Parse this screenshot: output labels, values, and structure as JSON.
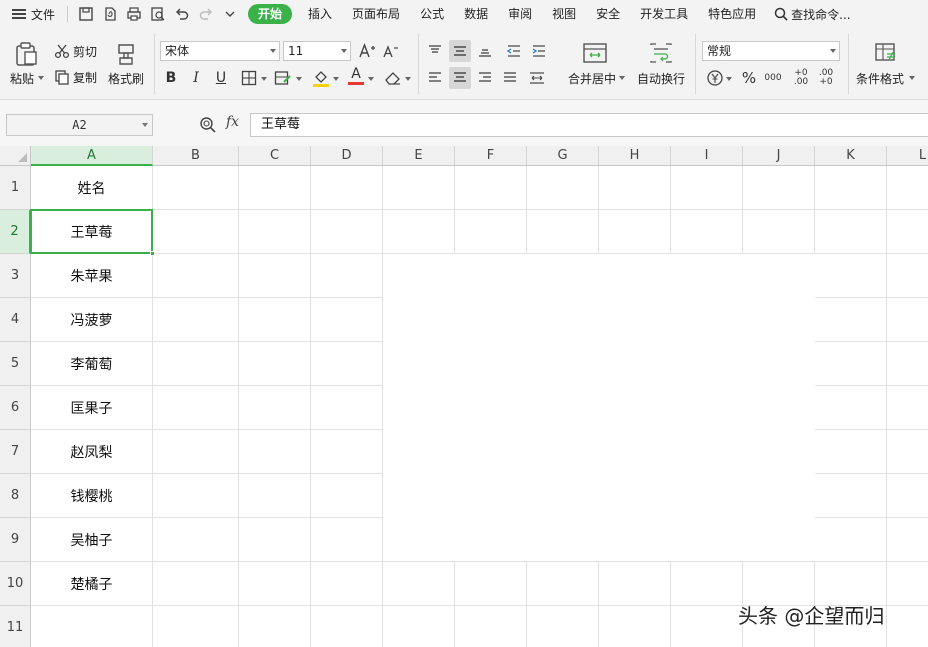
{
  "menubar": {
    "file": "文件",
    "tabs": [
      "开始",
      "插入",
      "页面布局",
      "公式",
      "数据",
      "审阅",
      "视图",
      "安全",
      "开发工具",
      "特色应用"
    ],
    "active_tab_index": 0,
    "search": "查找命令..."
  },
  "ribbon": {
    "paste": "粘贴",
    "cut": "剪切",
    "copy": "复制",
    "format_painter": "格式刷",
    "font_name": "宋体",
    "font_size": "11",
    "bold": "B",
    "italic": "I",
    "underline": "U",
    "font_color_letter": "A",
    "merge_center": "合并居中",
    "wrap_text": "自动换行",
    "number_format": "常规",
    "percent": "%",
    "thousands": "000",
    "inc_decimal": "+0 .00",
    "dec_decimal": ".00 +0",
    "conditional_format": "条件格式",
    "accent_color": "#3bb14a",
    "font_color_bar": "#e53935",
    "fill_color_bar": "#f5d20a"
  },
  "formula_bar": {
    "name_box": "A2",
    "fx": "fx",
    "content": "王草莓"
  },
  "sheet": {
    "columns": [
      "A",
      "B",
      "C",
      "D",
      "E",
      "F",
      "G",
      "H",
      "I",
      "J",
      "K",
      "L"
    ],
    "rows": [
      "1",
      "2",
      "3",
      "4",
      "5",
      "6",
      "7",
      "8",
      "9",
      "10",
      "11"
    ],
    "selected_column": "A",
    "selected_row": "2",
    "column_a_values": [
      "姓名",
      "王草莓",
      "朱苹果",
      "冯菠萝",
      "李葡萄",
      "匡果子",
      "赵凤梨",
      "钱樱桃",
      "吴柚子",
      "楚橘子",
      ""
    ]
  },
  "watermark": "头条 @企望而归"
}
